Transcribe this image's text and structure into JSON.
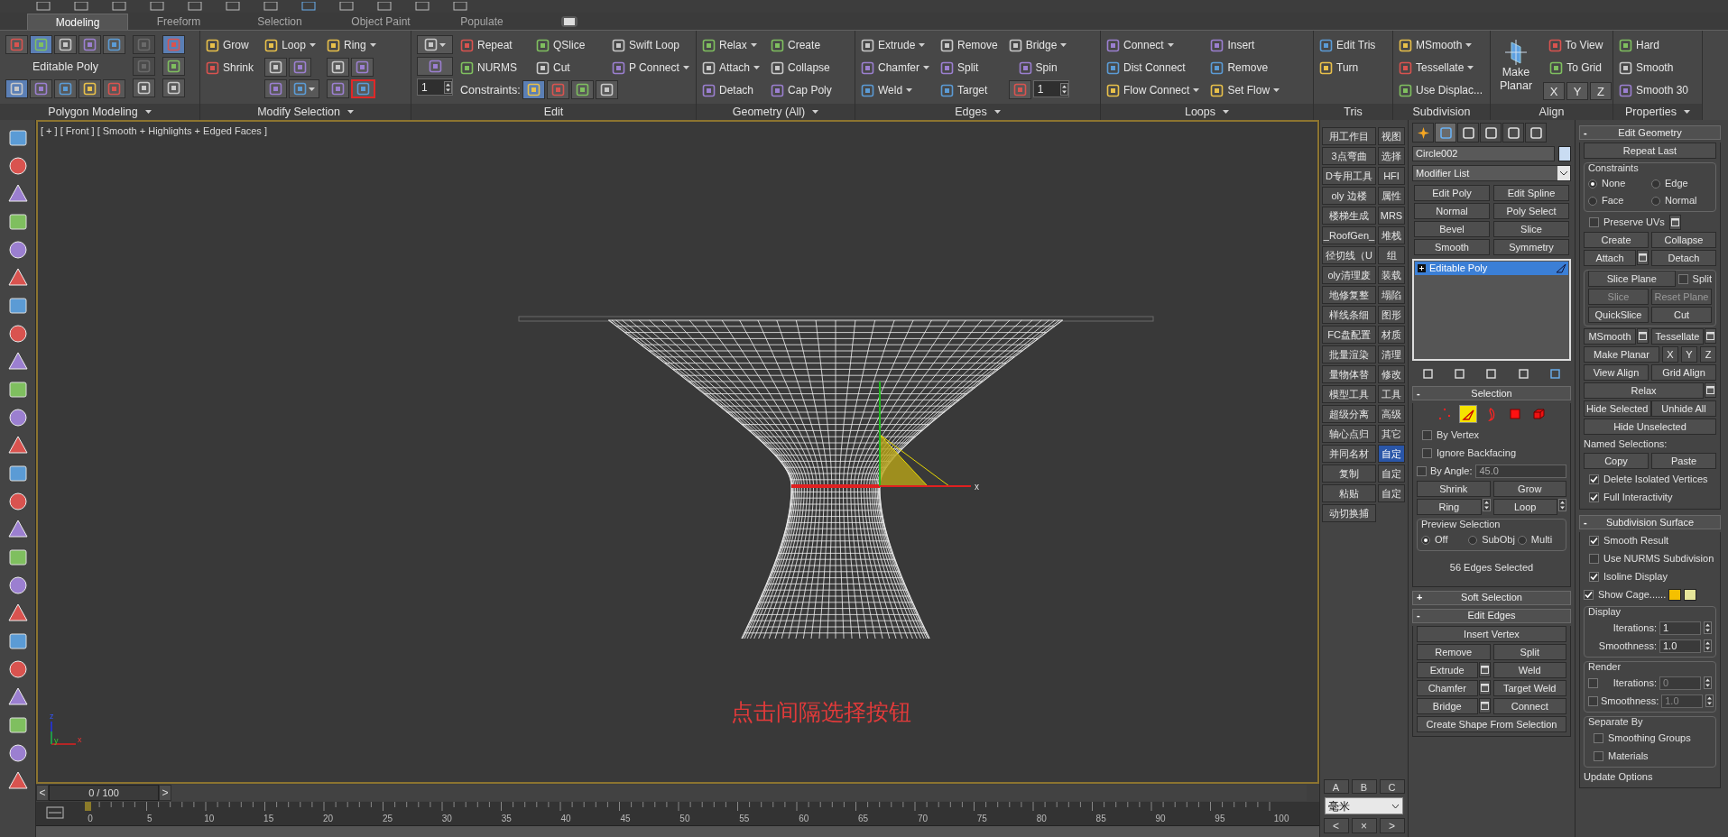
{
  "ribbon": {
    "tabs": [
      {
        "label": "Modeling",
        "selected": true
      },
      {
        "label": "Freeform",
        "selected": false
      },
      {
        "label": "Selection",
        "selected": false
      },
      {
        "label": "Object Paint",
        "selected": false
      },
      {
        "label": "Populate",
        "selected": false
      }
    ],
    "groups": [
      {
        "label": "Polygon Modeling",
        "dropdown": true,
        "sections": [
          {
            "kind": "rows",
            "rows": [
              [
                {
                  "kind": "icon",
                  "selected": false
                },
                {
                  "kind": "icon",
                  "selected": true
                },
                {
                  "kind": "icon",
                  "selected": false
                },
                {
                  "kind": "icon",
                  "selected": false
                },
                {
                  "kind": "icon",
                  "selected": false
                }
              ],
              [
                {
                  "kind": "caption",
                  "label": "Editable Poly"
                }
              ],
              [
                {
                  "kind": "icon",
                  "selected": true
                },
                {
                  "kind": "icon",
                  "selected": false
                },
                {
                  "kind": "icon",
                  "selected": false
                },
                {
                  "kind": "icon",
                  "selected": false
                },
                {
                  "kind": "icon",
                  "selected": false
                }
              ]
            ]
          },
          {
            "kind": "stack",
            "items": [
              {
                "kind": "icon",
                "disabled": true
              },
              {
                "kind": "icon",
                "disabled": true
              },
              {
                "kind": "icon",
                "disabled": false
              }
            ]
          },
          {
            "kind": "stack",
            "items": [
              {
                "kind": "icon",
                "selected": true
              },
              {
                "kind": "icon",
                "selected": false
              },
              {
                "kind": "icon",
                "selected": false
              }
            ]
          }
        ]
      },
      {
        "label": "Modify Selection",
        "dropdown": true,
        "sections": [
          {
            "kind": "stack",
            "items": [
              {
                "kind": "tool",
                "label": "Grow"
              },
              {
                "kind": "tool",
                "label": "Shrink"
              }
            ]
          },
          {
            "kind": "rows",
            "rows": [
              [
                {
                  "kind": "tool",
                  "label": "Loop",
                  "dropdown": true
                }
              ],
              [
                {
                  "kind": "icon"
                },
                {
                  "kind": "icon"
                }
              ],
              [
                {
                  "kind": "icon"
                },
                {
                  "kind": "icon",
                  "dropdown": true
                }
              ]
            ]
          },
          {
            "kind": "rows",
            "rows": [
              [
                {
                  "kind": "tool",
                  "label": "Ring",
                  "dropdown": true
                }
              ],
              [
                {
                  "kind": "icon"
                },
                {
                  "kind": "icon"
                }
              ],
              [
                {
                  "kind": "icon",
                  "annotated": false
                },
                {
                  "kind": "icon",
                  "annotated": true
                }
              ]
            ]
          }
        ]
      },
      {
        "label": "Edit",
        "dropdown": false,
        "sections": [
          {
            "kind": "stack",
            "items": [
              {
                "kind": "icon",
                "dropdown": true
              },
              {
                "kind": "icon"
              },
              {
                "kind": "spinner",
                "value": "1"
              }
            ]
          },
          {
            "kind": "rows",
            "rows": [
              [
                {
                  "kind": "tool",
                  "label": "Repeat"
                },
                {
                  "kind": "tool",
                  "label": "QSlice"
                },
                {
                  "kind": "tool",
                  "label": "Swift Loop"
                }
              ],
              [
                {
                  "kind": "tool",
                  "label": "NURMS"
                },
                {
                  "kind": "tool",
                  "label": "Cut"
                },
                {
                  "kind": "tool",
                  "label": "P Connect",
                  "dropdown": true
                }
              ],
              [
                {
                  "kind": "caption",
                  "label": "Constraints:"
                },
                {
                  "kind": "icon",
                  "selected": true
                },
                {
                  "kind": "icon",
                  "selected": false
                },
                {
                  "kind": "icon",
                  "selected": false
                },
                {
                  "kind": "icon",
                  "selected": false
                }
              ]
            ]
          }
        ]
      },
      {
        "label": "Geometry (All)",
        "dropdown": true,
        "sections": [
          {
            "kind": "stack",
            "items": [
              {
                "kind": "tool",
                "label": "Relax",
                "dropdown": true
              },
              {
                "kind": "tool",
                "label": "Attach",
                "dropdown": true
              },
              {
                "kind": "tool",
                "label": "Detach"
              }
            ]
          },
          {
            "kind": "stack",
            "items": [
              {
                "kind": "tool",
                "label": "Create"
              },
              {
                "kind": "tool",
                "label": "Collapse"
              },
              {
                "kind": "tool",
                "label": "Cap Poly"
              }
            ]
          }
        ]
      },
      {
        "label": "Edges",
        "dropdown": true,
        "sections": [
          {
            "kind": "stack",
            "items": [
              {
                "kind": "tool",
                "label": "Extrude",
                "dropdown": true
              },
              {
                "kind": "tool",
                "label": "Chamfer",
                "dropdown": true
              },
              {
                "kind": "tool",
                "label": "Weld",
                "dropdown": true
              }
            ]
          },
          {
            "kind": "stack",
            "items": [
              {
                "kind": "tool",
                "label": "Remove"
              },
              {
                "kind": "tool",
                "label": "Split"
              },
              {
                "kind": "tool",
                "label": "Target"
              }
            ]
          },
          {
            "kind": "rows",
            "rows": [
              [
                {
                  "kind": "tool",
                  "label": "Bridge",
                  "dropdown": true
                }
              ],
              [
                {
                  "kind": "tool",
                  "label": "Spin"
                }
              ],
              [
                {
                  "kind": "icon"
                },
                {
                  "kind": "spinner",
                  "value": "1"
                }
              ]
            ]
          }
        ]
      },
      {
        "label": "Loops",
        "dropdown": true,
        "sections": [
          {
            "kind": "stack",
            "items": [
              {
                "kind": "tool",
                "label": "Connect",
                "dropdown": true
              },
              {
                "kind": "tool",
                "label": "Dist Connect"
              },
              {
                "kind": "tool",
                "label": "Flow Connect",
                "dropdown": true
              }
            ]
          },
          {
            "kind": "stack",
            "items": [
              {
                "kind": "tool",
                "label": "Insert"
              },
              {
                "kind": "tool",
                "label": "Remove"
              },
              {
                "kind": "tool",
                "label": "Set  Flow",
                "dropdown": true
              }
            ]
          }
        ]
      },
      {
        "label": "Tris",
        "dropdown": false,
        "sections": [
          {
            "kind": "stack",
            "items": [
              {
                "kind": "tool",
                "label": "Edit Tris"
              },
              {
                "kind": "tool",
                "label": "Turn"
              }
            ]
          }
        ]
      },
      {
        "label": "Subdivision",
        "dropdown": false,
        "sections": [
          {
            "kind": "stack",
            "items": [
              {
                "kind": "tool",
                "label": "MSmooth",
                "dropdown": true
              },
              {
                "kind": "tool",
                "label": "Tessellate",
                "dropdown": true
              },
              {
                "kind": "tool",
                "label": "Use Displac..."
              }
            ]
          }
        ]
      },
      {
        "label": "Align",
        "dropdown": false,
        "sections": [
          {
            "kind": "stack",
            "items": [
              {
                "kind": "big",
                "label": "Make Planar"
              }
            ]
          },
          {
            "kind": "rows",
            "rows": [
              [
                {
                  "kind": "tool",
                  "label": "To View"
                }
              ],
              [
                {
                  "kind": "tool",
                  "label": "To Grid"
                }
              ],
              [
                {
                  "kind": "axis",
                  "label": "X"
                },
                {
                  "kind": "axis",
                  "label": "Y"
                },
                {
                  "kind": "axis",
                  "label": "Z"
                }
              ]
            ]
          }
        ]
      },
      {
        "label": "Properties",
        "dropdown": true,
        "sections": [
          {
            "kind": "stack",
            "items": [
              {
                "kind": "tool",
                "label": "Hard"
              },
              {
                "kind": "tool",
                "label": "Smooth"
              },
              {
                "kind": "tool",
                "label": "Smooth 30"
              }
            ]
          }
        ]
      }
    ]
  },
  "viewport": {
    "label": "[ + ] [ Front ] [ Smooth + Highlights + Edged Faces ]",
    "caption": "点击间隔选择按钮",
    "gizmo_label": "x",
    "axis_labels": [
      "z",
      "y",
      "x"
    ]
  },
  "timeline": {
    "prev": "<",
    "position": "0 / 100",
    "next": ">",
    "ticks": [
      "0",
      "5",
      "10",
      "15",
      "20",
      "25",
      "30",
      "35",
      "40",
      "45",
      "50",
      "55",
      "60",
      "65",
      "70",
      "75",
      "80",
      "85",
      "90",
      "95",
      "100"
    ]
  },
  "scripts": {
    "left": [
      "用工作目",
      "3点弯曲",
      "D专用工具",
      "oly 边楼",
      "楼梯生成",
      "_RoofGen_",
      "径切线（U",
      "oly清理废",
      "地修复整",
      "样线条细",
      "FC盘配置",
      "批量渲染",
      "量物体替",
      "模型工具",
      "超级分离",
      "轴心点归",
      "并同名材",
      "复制",
      "粘贴",
      "动切换捕"
    ],
    "right": [
      {
        "label": "视图",
        "selected": false
      },
      {
        "label": "选择",
        "selected": false
      },
      {
        "label": "HFI",
        "selected": false
      },
      {
        "label": "属性",
        "selected": false
      },
      {
        "label": "MRS",
        "selected": false
      },
      {
        "label": "堆栈",
        "selected": false
      },
      {
        "label": "组",
        "selected": false
      },
      {
        "label": "装载",
        "selected": false
      },
      {
        "label": "塌陷",
        "selected": false
      },
      {
        "label": "图形",
        "selected": false
      },
      {
        "label": "材质",
        "selected": false
      },
      {
        "label": "清理",
        "selected": false
      },
      {
        "label": "修改",
        "selected": false
      },
      {
        "label": "工具",
        "selected": false
      },
      {
        "label": "高级",
        "selected": false
      },
      {
        "label": "其它",
        "selected": false
      },
      {
        "label": "自定",
        "selected": true
      },
      {
        "label": "自定",
        "selected": false
      },
      {
        "label": "自定",
        "selected": false
      }
    ],
    "abc": [
      "A",
      "B",
      "C"
    ],
    "unit": "毫米",
    "nav": [
      "<",
      "×",
      ">"
    ]
  },
  "command_panel": {
    "tabs": [
      {
        "selected": false
      },
      {
        "selected": true
      },
      {
        "selected": false
      },
      {
        "selected": false
      },
      {
        "selected": false
      },
      {
        "selected": false
      }
    ],
    "object_name": "Circle002",
    "modifier_list": "Modifier List",
    "modifier_buttons": [
      "Edit Poly",
      "Edit Spline",
      "Normal",
      "Poly Select",
      "Bevel",
      "Slice",
      "Smooth",
      "Symmetry"
    ],
    "stack": [
      {
        "label": "Editable Poly",
        "selected": true
      }
    ],
    "rollouts": [
      {
        "toggle": "-",
        "title": "Selection",
        "sections": [
          {
            "rows": [
              [
                {
                  "kind": "subobj",
                  "selected": false
                },
                {
                  "kind": "subobj",
                  "selected": true
                },
                {
                  "kind": "subobj",
                  "selected": false
                },
                {
                  "kind": "subobj",
                  "selected": false
                },
                {
                  "kind": "subobj",
                  "selected": false
                }
              ],
              [
                {
                  "kind": "check",
                  "label": "By Vertex",
                  "checked": false
                }
              ],
              [
                {
                  "kind": "check",
                  "label": "Ignore Backfacing",
                  "checked": false
                }
              ],
              [
                {
                  "kind": "check_field",
                  "label": "By Angle:",
                  "checked": false,
                  "value": "45.0"
                }
              ],
              [
                {
                  "kind": "button",
                  "label": "Shrink"
                },
                {
                  "kind": "button",
                  "label": "Grow"
                }
              ],
              [
                {
                  "kind": "button",
                  "label": "Ring",
                  "spin": true
                },
                {
                  "kind": "button",
                  "label": "Loop",
                  "spin": true
                }
              ]
            ]
          },
          {
            "framed": true,
            "title": "Preview Selection",
            "rows": [
              [
                {
                  "kind": "radio",
                  "label": "Off",
                  "selected": true
                },
                {
                  "kind": "radio",
                  "label": "SubObj",
                  "selected": false
                },
                {
                  "kind": "radio",
                  "label": "Multi",
                  "selected": false
                }
              ]
            ]
          },
          {
            "rows": [
              [
                {
                  "kind": "status",
                  "label": "56 Edges Selected"
                }
              ]
            ]
          }
        ]
      },
      {
        "toggle": "+",
        "title": "Soft Selection"
      },
      {
        "toggle": "-",
        "title": "Edit Edges",
        "sections": [
          {
            "rows": [
              [
                {
                  "kind": "button",
                  "label": "Insert Vertex"
                }
              ],
              [
                {
                  "kind": "button",
                  "label": "Remove"
                },
                {
                  "kind": "button",
                  "label": "Split"
                }
              ],
              [
                {
                  "kind": "button",
                  "label": "Extrude",
                  "settings": true
                },
                {
                  "kind": "button",
                  "label": "Weld"
                }
              ],
              [
                {
                  "kind": "button",
                  "label": "Chamfer",
                  "settings": true
                },
                {
                  "kind": "button",
                  "label": "Target Weld"
                }
              ],
              [
                {
                  "kind": "button",
                  "label": "Bridge",
                  "settings": true
                },
                {
                  "kind": "button",
                  "label": "Connect"
                }
              ],
              [
                {
                  "kind": "button",
                  "label": "Create Shape From Selection"
                }
              ]
            ]
          }
        ]
      }
    ]
  },
  "geometry_panel": {
    "rollouts": [
      {
        "toggle": "-",
        "title": "Edit Geometry",
        "sections": [
          {
            "rows": [
              [
                {
                  "kind": "button",
                  "label": "Repeat Last"
                }
              ]
            ]
          },
          {
            "framed": true,
            "title": "Constraints",
            "rows": [
              [
                {
                  "kind": "radio",
                  "label": "None",
                  "selected": true
                },
                {
                  "kind": "radio",
                  "label": "Edge",
                  "selected": false
                }
              ],
              [
                {
                  "kind": "radio",
                  "label": "Face",
                  "selected": false
                },
                {
                  "kind": "radio",
                  "label": "Normal",
                  "selected": false
                }
              ]
            ]
          },
          {
            "rows": [
              [
                {
                  "kind": "check",
                  "label": "Preserve UVs",
                  "checked": false,
                  "settings": true
                }
              ],
              [
                {
                  "kind": "button",
                  "label": "Create"
                },
                {
                  "kind": "button",
                  "label": "Collapse"
                }
              ],
              [
                {
                  "kind": "button",
                  "label": "Attach",
                  "settings": true
                },
                {
                  "kind": "button",
                  "label": "Detach"
                }
              ]
            ]
          },
          {
            "framed": true,
            "rows": [
              [
                {
                  "kind": "button",
                  "label": "Slice Plane"
                },
                {
                  "kind": "check",
                  "label": "Split",
                  "checked": false
                }
              ],
              [
                {
                  "kind": "button",
                  "label": "Slice",
                  "disabled": true
                },
                {
                  "kind": "button",
                  "label": "Reset Plane",
                  "disabled": true
                }
              ],
              [
                {
                  "kind": "button",
                  "label": "QuickSlice"
                },
                {
                  "kind": "button",
                  "label": "Cut"
                }
              ]
            ]
          },
          {
            "rows": [
              [
                {
                  "kind": "button",
                  "label": "MSmooth",
                  "settings": true
                },
                {
                  "kind": "button",
                  "label": "Tessellate",
                  "settings": true
                }
              ],
              [
                {
                  "kind": "button",
                  "label": "Make Planar"
                },
                {
                  "kind": "axis",
                  "label": "X"
                },
                {
                  "kind": "axis",
                  "label": "Y"
                },
                {
                  "kind": "axis",
                  "label": "Z"
                }
              ],
              [
                {
                  "kind": "button",
                  "label": "View Align"
                },
                {
                  "kind": "button",
                  "label": "Grid Align"
                }
              ],
              [
                {
                  "kind": "button",
                  "label": "Relax",
                  "settings": true
                }
              ],
              [
                {
                  "kind": "button",
                  "label": "Hide Selected"
                },
                {
                  "kind": "button",
                  "label": "Unhide All"
                }
              ],
              [
                {
                  "kind": "button",
                  "label": "Hide Unselected"
                }
              ],
              [
                {
                  "kind": "text",
                  "label": "Named Selections:"
                }
              ],
              [
                {
                  "kind": "button",
                  "label": "Copy"
                },
                {
                  "kind": "button",
                  "label": "Paste"
                }
              ],
              [
                {
                  "kind": "check",
                  "label": "Delete Isolated Vertices",
                  "checked": true
                }
              ],
              [
                {
                  "kind": "check",
                  "label": "Full Interactivity",
                  "checked": true
                }
              ]
            ]
          }
        ]
      },
      {
        "toggle": "-",
        "title": "Subdivision Surface",
        "sections": [
          {
            "rows": [
              [
                {
                  "kind": "check",
                  "label": "Smooth Result",
                  "checked": true
                }
              ],
              [
                {
                  "kind": "check",
                  "label": "Use NURMS Subdivision",
                  "checked": false
                }
              ],
              [
                {
                  "kind": "check",
                  "label": "Isoline Display",
                  "checked": true
                }
              ],
              [
                {
                  "kind": "check",
                  "label": "Show Cage......",
                  "checked": true
                },
                {
                  "kind": "swatch",
                  "color": "#f5c000"
                },
                {
                  "kind": "swatch",
                  "color": "#e6e69a"
                }
              ]
            ]
          },
          {
            "framed": true,
            "title": "Display",
            "rows": [
              [
                {
                  "kind": "spinner",
                  "label": "Iterations:",
                  "value": "1"
                }
              ],
              [
                {
                  "kind": "spinner",
                  "label": "Smoothness:",
                  "value": "1.0"
                }
              ]
            ]
          },
          {
            "framed": true,
            "title": "Render",
            "rows": [
              [
                {
                  "kind": "spinner",
                  "label": "Iterations:",
                  "value": "0",
                  "checked": false
                }
              ],
              [
                {
                  "kind": "spinner",
                  "label": "Smoothness:",
                  "value": "1.0",
                  "checked": false
                }
              ]
            ]
          },
          {
            "framed": true,
            "title": "Separate By",
            "rows": [
              [
                {
                  "kind": "check",
                  "label": "Smoothing Groups",
                  "checked": false
                }
              ],
              [
                {
                  "kind": "check",
                  "label": "Materials",
                  "checked": false
                }
              ]
            ]
          },
          {
            "rows": [
              [
                {
                  "kind": "text",
                  "label": "Update Options"
                }
              ]
            ]
          }
        ]
      }
    ]
  }
}
